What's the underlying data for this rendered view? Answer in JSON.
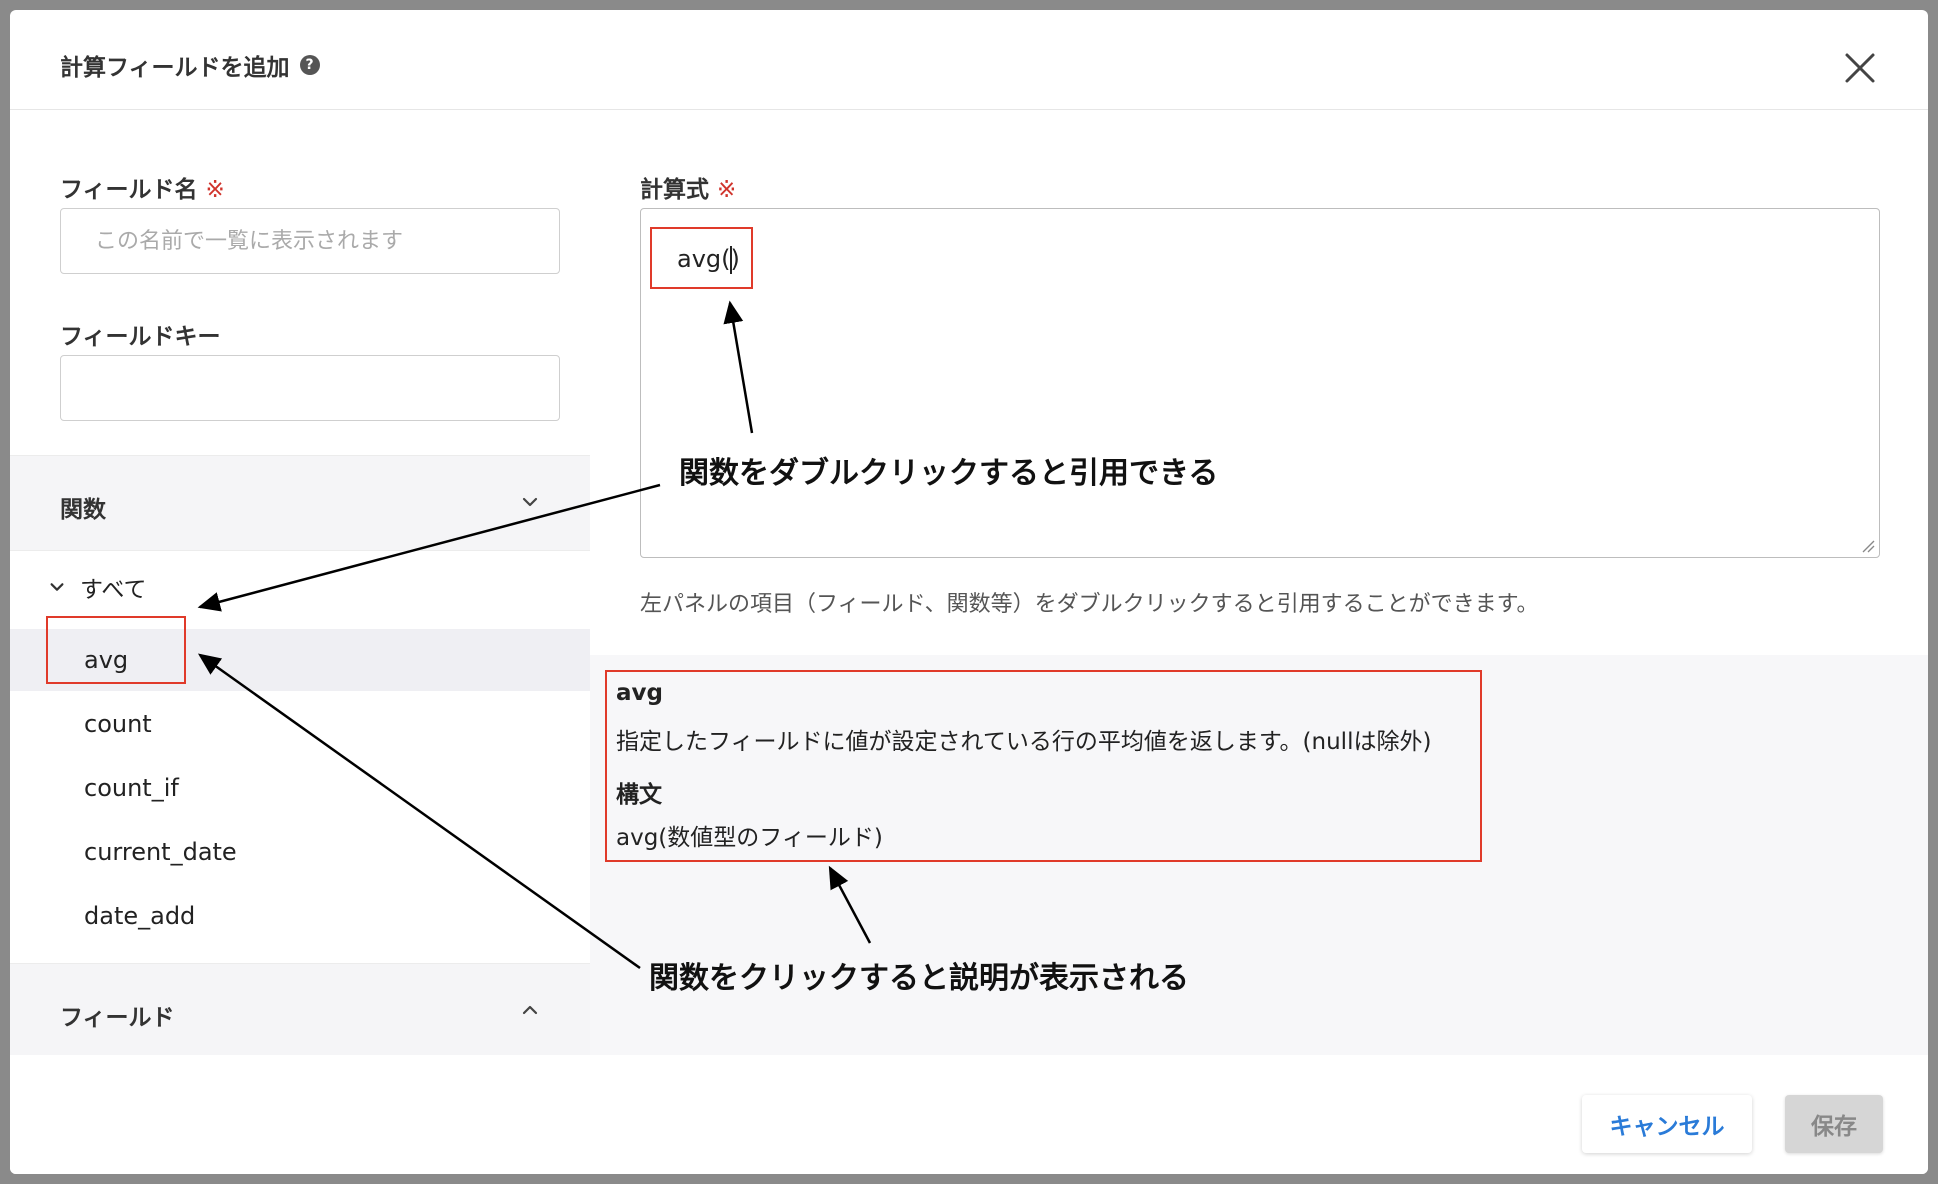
{
  "dialog": {
    "title": "計算フィールドを追加",
    "help_icon_text": "?"
  },
  "form": {
    "field_name_label": "フィールド名",
    "required_mark": "※",
    "field_name_placeholder": "この名前で一覧に表示されます",
    "field_name_value": "",
    "field_key_label": "フィールドキー",
    "field_key_value": "",
    "formula_label": "計算式",
    "formula_value": "avg()",
    "formula_before_caret": "avg(",
    "formula_after_caret": ")",
    "hint": "左パネルの項目（フィールド、関数等）をダブルクリックすると引用することができます。"
  },
  "sidebar": {
    "functions_section": "関数",
    "all_group": "すべて",
    "functions": [
      "avg",
      "count",
      "count_if",
      "current_date",
      "date_add"
    ],
    "selected_function": "avg",
    "fields_section": "フィールド"
  },
  "description": {
    "name": "avg",
    "text": "指定したフィールドに値が設定されている行の平均値を返します。(nullは除外)",
    "syntax_label": "構文",
    "syntax": "avg(数値型のフィールド)"
  },
  "footer": {
    "cancel_label": "キャンセル",
    "save_label": "保存"
  },
  "annotations": {
    "double_click": "関数をダブルクリックすると引用できる",
    "click": "関数をクリックすると説明が表示される"
  },
  "colors": {
    "highlight": "#e03a2a",
    "accent": "#2a7bd8",
    "required": "#d0342c"
  }
}
